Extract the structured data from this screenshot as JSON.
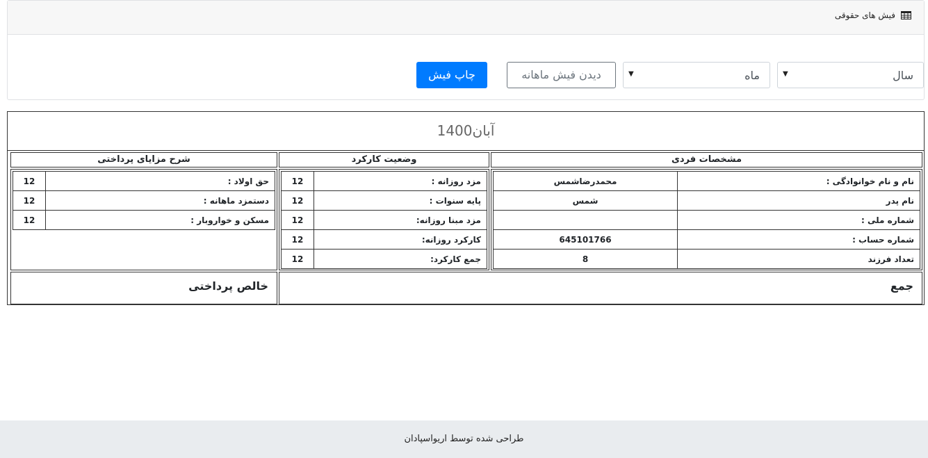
{
  "header": {
    "title": "فیش های حقوقی",
    "icon": "table-icon"
  },
  "controls": {
    "year_select": "سال",
    "month_select": "ماه",
    "view_button": "دیدن فیش ماهانه",
    "print_button": "چاپ فیش"
  },
  "slip": {
    "title": "آبان1400",
    "sections": {
      "personal": "مشخصات فردی",
      "work": "وضعیت کارکرد",
      "benefits": "شرح مزایای پرداختی"
    },
    "personal_rows": [
      {
        "label": "نام و نام خوانوادگی :",
        "value": "محمدرضاشمس"
      },
      {
        "label": "نام پدر",
        "value": "شمس"
      },
      {
        "label": "شماره ملی :",
        "value": ""
      },
      {
        "label": "شماره حساب :",
        "value": "645101766"
      },
      {
        "label": "تعداد فرزند",
        "value": "8"
      }
    ],
    "work_rows": [
      {
        "label": "مزد روزانه :",
        "value": "12"
      },
      {
        "label": "پایه سنوات :",
        "value": "12"
      },
      {
        "label": "مزد مبنا روزانه:",
        "value": "12"
      },
      {
        "label": "کارکرد روزانه:",
        "value": "12"
      },
      {
        "label": "جمع کارکرد:",
        "value": "12"
      }
    ],
    "benefit_rows": [
      {
        "label": "حق اولاد :",
        "value": "12"
      },
      {
        "label": "دستمزد ماهانه :",
        "value": "12"
      },
      {
        "label": "مسکن و خواروبار :",
        "value": "12"
      }
    ],
    "total_label": "جمع",
    "net_label": "خالص پرداختی"
  },
  "footer": {
    "text": "طراحی شده توسط اریواسپادان"
  }
}
